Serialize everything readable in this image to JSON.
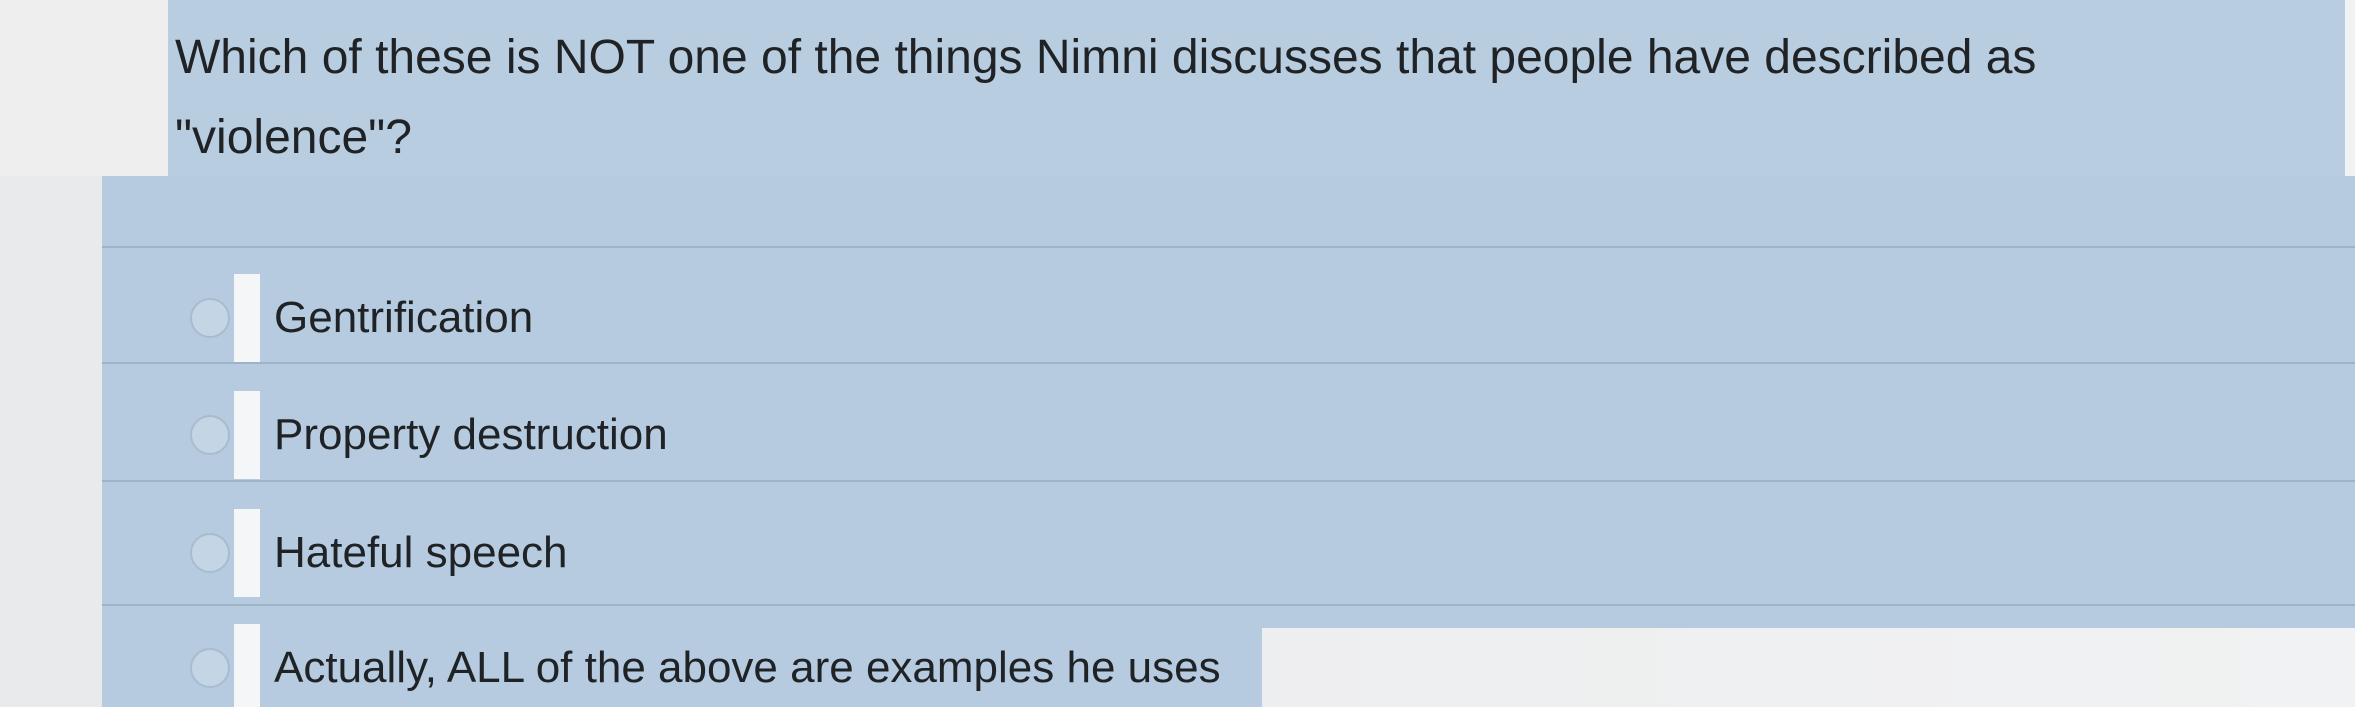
{
  "question": {
    "text": "Which of these is NOT one of the things Nimni discusses that people have described as \"violence\"?"
  },
  "options": [
    {
      "label": "Gentrification"
    },
    {
      "label": "Property destruction"
    },
    {
      "label": "Hateful speech"
    },
    {
      "label": "Actually, ALL of the above are examples he uses"
    }
  ],
  "colors": {
    "highlight": "#b6cbdf",
    "text": "#1f2326",
    "background": "#ecedee"
  }
}
